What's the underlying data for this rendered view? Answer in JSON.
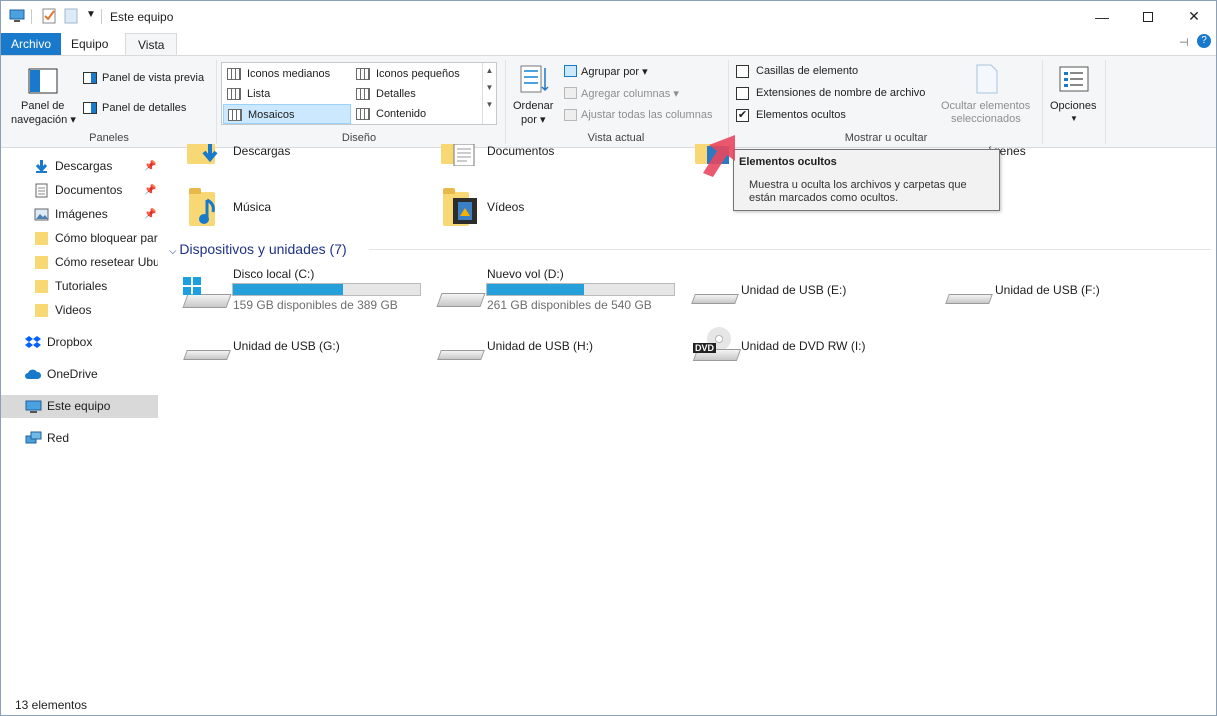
{
  "titlebar": {
    "title": "Este equipo",
    "minimize_icon": "minimize-icon",
    "maximize_icon": "maximize-icon",
    "close_icon": "close-icon"
  },
  "tabs": [
    {
      "label": "Archivo"
    },
    {
      "label": "Equipo"
    },
    {
      "label": "Vista"
    }
  ],
  "ribbon": {
    "panes": {
      "nav_pane_label_1": "Panel de",
      "nav_pane_label_2": "navegación",
      "preview_pane": "Panel de vista previa",
      "details_pane": "Panel de detalles",
      "group_label": "Paneles"
    },
    "layout": {
      "items": [
        "Iconos medianos",
        "Iconos pequeños",
        "Lista",
        "Detalles",
        "Mosaicos",
        "Contenido"
      ],
      "selected": "Mosaicos",
      "group_label": "Diseño"
    },
    "current_view": {
      "sort_1": "Ordenar",
      "sort_2": "por",
      "group_by": "Agrupar por",
      "add_columns": "Agregar columnas",
      "fit_columns": "Ajustar todas las columnas",
      "group_label": "Vista actual"
    },
    "show_hide": {
      "item_checkboxes": "Casillas de elemento",
      "file_extensions": "Extensiones de nombre de archivo",
      "hidden_items": "Elementos ocultos",
      "hide_selected_1": "Ocultar elementos",
      "hide_selected_2": "seleccionados",
      "group_label": "Mostrar u ocultar",
      "item_checkboxes_checked": false,
      "file_extensions_checked": false,
      "hidden_items_checked": true
    },
    "options": "Opciones"
  },
  "nav": {
    "items": [
      {
        "label": "Descargas",
        "icon": "download-icon",
        "pinned": true
      },
      {
        "label": "Documentos",
        "icon": "document-icon",
        "pinned": true
      },
      {
        "label": "Imágenes",
        "icon": "image-icon",
        "pinned": true
      },
      {
        "label": "Cómo bloquear par",
        "icon": "folder-icon",
        "pinned": false
      },
      {
        "label": "Cómo resetear Ubu",
        "icon": "folder-icon",
        "pinned": false
      },
      {
        "label": "Tutoriales",
        "icon": "folder-icon",
        "pinned": false
      },
      {
        "label": "Videos",
        "icon": "folder-icon",
        "pinned": false
      },
      {
        "label": "Dropbox",
        "icon": "dropbox-icon"
      },
      {
        "label": "OneDrive",
        "icon": "cloud-icon"
      },
      {
        "label": "Este equipo",
        "icon": "computer-icon",
        "selected": true
      },
      {
        "label": "Red",
        "icon": "network-icon"
      }
    ]
  },
  "folders": [
    {
      "label": "Descargas"
    },
    {
      "label": "Documentos"
    },
    {
      "label": "Imágenes"
    },
    {
      "label": "Música"
    },
    {
      "label": "Vídeos"
    }
  ],
  "devices": {
    "heading": "Dispositivos y unidades (7)",
    "items": [
      {
        "label": "Disco local (C:)",
        "sub": "159 GB disponibles de 389 GB",
        "used_fraction": 0.59
      },
      {
        "label": "Nuevo vol (D:)",
        "sub": "261 GB disponibles de 540 GB",
        "used_fraction": 0.52
      },
      {
        "label": "Unidad de USB (E:)"
      },
      {
        "label": "Unidad de USB (F:)"
      },
      {
        "label": "Unidad de USB (G:)"
      },
      {
        "label": "Unidad de USB (H:)"
      },
      {
        "label": "Unidad de DVD RW (I:)",
        "badge": "DVD"
      }
    ]
  },
  "tooltip": {
    "title": "Elementos ocultos",
    "line1": "Muestra u oculta los archivos y carpetas que",
    "line2": "están marcados como ocultos."
  },
  "status": {
    "count": "13 elementos"
  },
  "colors": {
    "accent": "#1979ca",
    "selection": "#cce8ff",
    "drive_bar": "#26a0da",
    "arrow": "#e8475f"
  }
}
